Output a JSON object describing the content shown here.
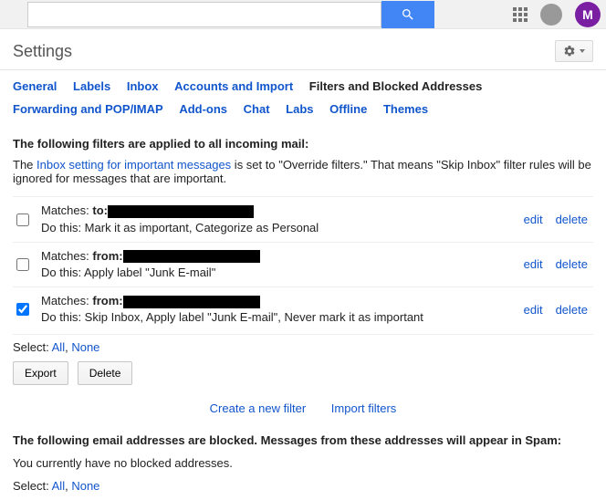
{
  "header": {
    "avatar_letter": "M",
    "settings_title": "Settings"
  },
  "tabs": {
    "general": "General",
    "labels": "Labels",
    "inbox": "Inbox",
    "accounts": "Accounts and Import",
    "filters": "Filters and Blocked Addresses",
    "forwarding": "Forwarding and POP/IMAP",
    "addons": "Add-ons",
    "chat": "Chat",
    "labs": "Labs",
    "offline": "Offline",
    "themes": "Themes"
  },
  "filters_section": {
    "title": "The following filters are applied to all incoming mail:",
    "note_pre": "The ",
    "note_link": "Inbox setting for important messages",
    "note_post": " is set to \"Override filters.\" That means \"Skip Inbox\" filter rules will be ignored for messages that are important.",
    "rows": [
      {
        "checked": false,
        "match_label": "Matches: ",
        "match_field": "to:",
        "action": "Do this: Mark it as important, Categorize as Personal"
      },
      {
        "checked": false,
        "match_label": "Matches: ",
        "match_field": "from:",
        "action": "Do this: Apply label \"Junk E-mail\""
      },
      {
        "checked": true,
        "match_label": "Matches: ",
        "match_field": "from:",
        "action": "Do this: Skip Inbox, Apply label \"Junk E-mail\", Never mark it as important"
      }
    ],
    "edit": "edit",
    "delete": "delete",
    "select_label": "Select: ",
    "select_all": "All",
    "select_sep": ", ",
    "select_none": "None",
    "export_btn": "Export",
    "delete_btn": "Delete",
    "create_link": "Create a new filter",
    "import_link": "Import filters"
  },
  "blocked_section": {
    "title": "The following email addresses are blocked. Messages from these addresses will appear in Spam:",
    "empty": "You currently have no blocked addresses.",
    "select_label": "Select: ",
    "select_all": "All",
    "select_sep": ", ",
    "select_none": "None"
  }
}
